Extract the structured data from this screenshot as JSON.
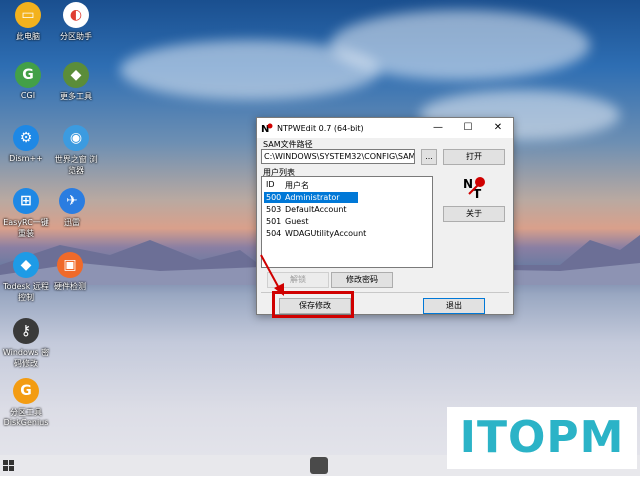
{
  "desktop": {
    "icons": [
      {
        "label": "此电脑",
        "color": "#f3b21d",
        "glyph": "▭"
      },
      {
        "label": "分区助手",
        "color": "#ffffff",
        "glyph": "◐"
      },
      {
        "label": "CGI",
        "color": "#43a047",
        "glyph": "G"
      },
      {
        "label": "更多工具",
        "color": "#5b8d3a",
        "glyph": "◆"
      },
      {
        "label": "Dism++",
        "color": "#1e88e5",
        "glyph": "⚙"
      },
      {
        "label": "世界之窗 浏览器",
        "color": "#3c9be0",
        "glyph": "◉"
      },
      {
        "label": "EasyRC一键重装",
        "color": "#1e88e5",
        "glyph": "⊞"
      },
      {
        "label": "迅雷",
        "color": "#2a7de1",
        "glyph": "✈"
      },
      {
        "label": "Todesk 远程控制",
        "color": "#1e9be6",
        "glyph": "◆"
      },
      {
        "label": "硬件检测",
        "color": "#f06a2a",
        "glyph": "▣"
      },
      {
        "label": "Windows 密码修改",
        "color": "#3a3a3a",
        "glyph": "⚷"
      },
      {
        "label": "分区工具 DiskGenius",
        "color": "#f39c12",
        "glyph": "G"
      }
    ]
  },
  "window": {
    "title": "NTPWEdit 0.7 (64-bit)",
    "sam_label": "SAM文件路径",
    "sam_path": "C:\\WINDOWS\\SYSTEM32\\CONFIG\\SAM",
    "browse_label": "...",
    "open_label": "打开",
    "users_label": "用户列表",
    "col_id": "ID",
    "col_name": "用户名",
    "users": [
      {
        "id": "500",
        "name": "Administrator",
        "selected": true
      },
      {
        "id": "503",
        "name": "DefaultAccount",
        "selected": false
      },
      {
        "id": "501",
        "name": "Guest",
        "selected": false
      },
      {
        "id": "504",
        "name": "WDAGUtilityAccount",
        "selected": false
      }
    ],
    "about_label": "关于",
    "unlock_label": "解锁",
    "change_password_label": "修改密码",
    "save_label": "保存修改",
    "exit_label": "退出"
  },
  "watermark": {
    "text": "ITOPM"
  },
  "colors": {
    "accent": "#0078d7",
    "highlight": "#d00000",
    "watermark": "#2bb3c7"
  }
}
